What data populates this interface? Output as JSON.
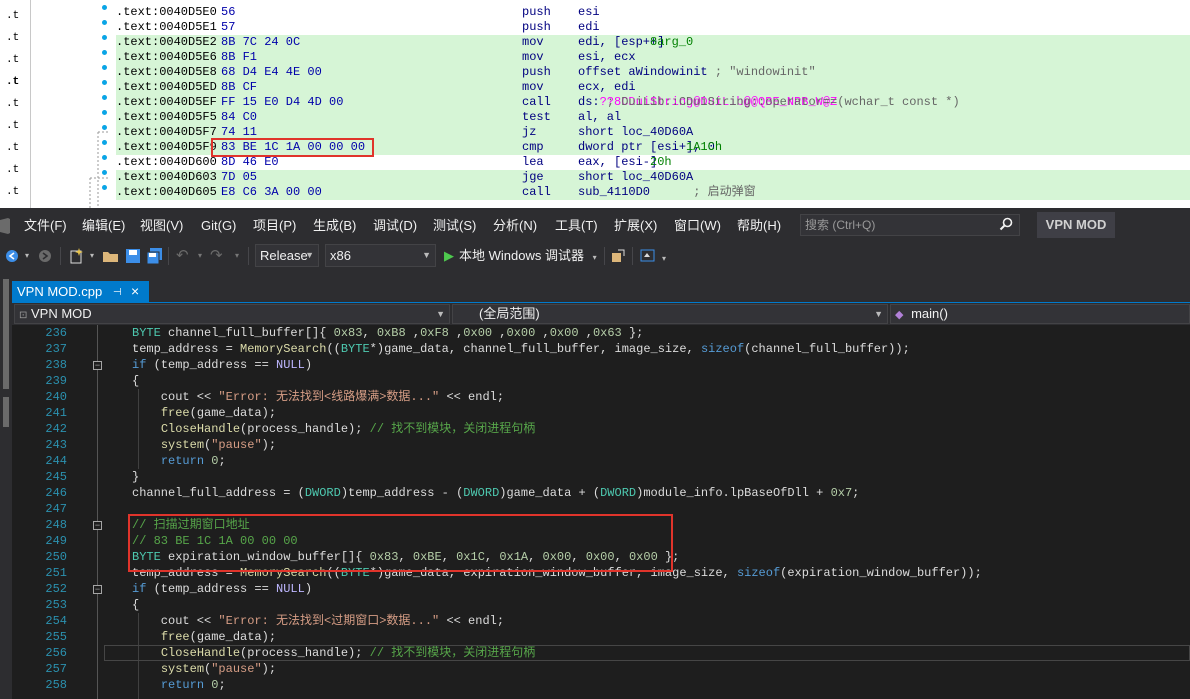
{
  "ida": {
    "gutter_labels": [
      ".t",
      ".t",
      ".t",
      ".t",
      ".t",
      ".t",
      ".t",
      ".t",
      ".t",
      ".t",
      ".t",
      ".t"
    ],
    "rows": [
      {
        "addr": ".text:0040D5E0",
        "bytes": "56",
        "mnemonic": "push",
        "operand": "esi",
        "hl": false
      },
      {
        "addr": ".text:0040D5E1",
        "bytes": "57",
        "mnemonic": "push",
        "operand": "edi",
        "hl": false
      },
      {
        "addr": ".text:0040D5E2",
        "bytes": "8B 7C 24 0C",
        "mnemonic": "mov",
        "operand": "edi, [esp+8+arg_0]",
        "hl": true
      },
      {
        "addr": ".text:0040D5E6",
        "bytes": "8B F1",
        "mnemonic": "mov",
        "operand": "esi, ecx",
        "hl": true
      },
      {
        "addr": ".text:0040D5E8",
        "bytes": "68 D4 E4 4E 00",
        "mnemonic": "push",
        "operand": "offset aWindowinit ; \"windowinit\"",
        "hl": true
      },
      {
        "addr": ".text:0040D5ED",
        "bytes": "8B CF",
        "mnemonic": "mov",
        "operand": "ecx, edi",
        "hl": true
      },
      {
        "addr": ".text:0040D5EF",
        "bytes": "FF 15 E0 D4 4D 00",
        "mnemonic": "call",
        "operand": "ds:??8CDuiString@DuiLib@@QBE_NPB_W@Z ; DuiLib::CDuiString::operator==(wchar_t const *)",
        "hl": true
      },
      {
        "addr": ".text:0040D5F5",
        "bytes": "84 C0",
        "mnemonic": "test",
        "operand": "al, al",
        "hl": true
      },
      {
        "addr": ".text:0040D5F7",
        "bytes": "74 11",
        "mnemonic": "jz",
        "operand": "short loc_40D60A",
        "hl": true
      },
      {
        "addr": ".text:0040D5F9",
        "bytes": "83 BE 1C 1A 00 00 00",
        "mnemonic": "cmp",
        "operand": "dword ptr [esi+1A1Ch], 0",
        "hl": true
      },
      {
        "addr": ".text:0040D600",
        "bytes": "8D 46 E0",
        "mnemonic": "lea",
        "operand": "eax, [esi-20h]",
        "hl": false
      },
      {
        "addr": ".text:0040D603",
        "bytes": "7D 05",
        "mnemonic": "jge",
        "operand": "short loc_40D60A",
        "hl": true
      },
      {
        "addr": ".text:0040D605",
        "bytes": "E8 C6 3A 00 00",
        "mnemonic": "call",
        "operand": "sub_4110D0      ; 启动弹窗",
        "hl": true
      }
    ]
  },
  "menu": {
    "items": [
      "文件(F)",
      "编辑(E)",
      "视图(V)",
      "Git(G)",
      "项目(P)",
      "生成(B)",
      "调试(D)",
      "测试(S)",
      "分析(N)",
      "工具(T)",
      "扩展(X)",
      "窗口(W)",
      "帮助(H)"
    ],
    "search_placeholder": "搜索 (Ctrl+Q)",
    "project_name": "VPN MOD"
  },
  "toolbar": {
    "config": "Release",
    "platform": "x86",
    "run_label": "本地 Windows 调试器"
  },
  "tab": {
    "file_name": "VPN MOD.cpp",
    "pin": "⊣",
    "close": "×"
  },
  "nav": {
    "project": "VPN MOD",
    "scope": "(全局范围)",
    "member": "main()"
  },
  "editor": {
    "line_numbers": [
      "236",
      "237",
      "238",
      "239",
      "240",
      "241",
      "242",
      "243",
      "244",
      "245",
      "246",
      "247",
      "248",
      "249",
      "250",
      "251",
      "252",
      "253",
      "254",
      "255",
      "256",
      "257",
      "258"
    ],
    "lines": [
      "BYTE channel_full_buffer[]{ 0x83, 0xB8 ,0xF8 ,0x00 ,0x00 ,0x00 ,0x63 };",
      "temp_address = MemorySearch((BYTE*)game_data, channel_full_buffer, image_size, sizeof(channel_full_buffer));",
      "if (temp_address == NULL)",
      "{",
      "    cout << \"Error: 无法找到<线路爆满>数据...\" << endl;",
      "    free(game_data);",
      "    CloseHandle(process_handle); // 找不到模块，关闭进程句柄",
      "    system(\"pause\");",
      "    return 0;",
      "}",
      "channel_full_address = (DWORD)temp_address - (DWORD)game_data + (DWORD)module_info.lpBaseOfDll + 0x7;",
      "",
      "// 扫描过期窗口地址",
      "// 83 BE 1C 1A 00 00 00",
      "BYTE expiration_window_buffer[]{ 0x83, 0xBE, 0x1C, 0x1A, 0x00, 0x00, 0x00 };",
      "temp_address = MemorySearch((BYTE*)game_data, expiration_window_buffer, image_size, sizeof(expiration_window_buffer));",
      "if (temp_address == NULL)",
      "{",
      "    cout << \"Error: 无法找到<过期窗口>数据...\" << endl;",
      "    free(game_data);",
      "    CloseHandle(process_handle); // 找不到模块，关闭进程句柄",
      "    system(\"pause\");",
      "    return 0;"
    ]
  }
}
